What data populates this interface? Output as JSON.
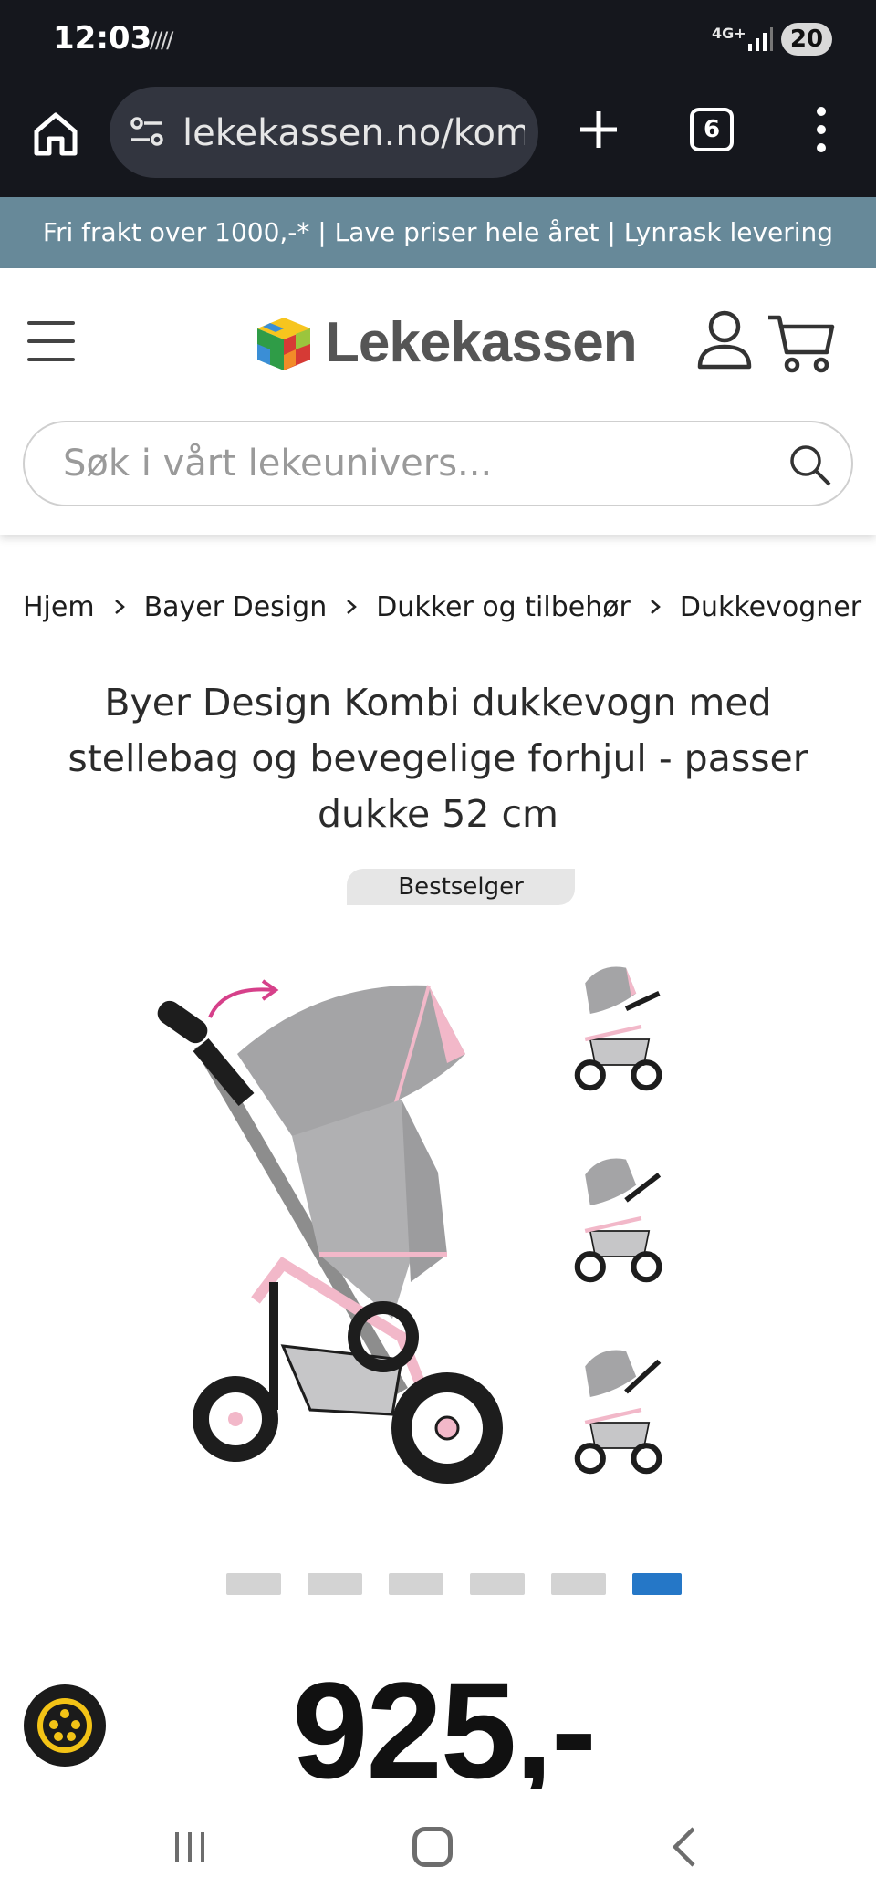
{
  "status_bar": {
    "time": "12:03",
    "extra_icon": "////",
    "network": "4G+",
    "battery": "20"
  },
  "browser": {
    "url": "lekekassen.no/kombi",
    "tab_count": "6"
  },
  "promo_banner": "Fri frakt over 1000,-* | Lave priser hele året | Lynrask levering",
  "header": {
    "logo_text": "Lekekassen",
    "search_placeholder": "Søk i vårt lekeunivers..."
  },
  "breadcrumb": [
    "Hjem",
    "Bayer Design",
    "Dukker og tilbehør",
    "Dukkevogner"
  ],
  "product": {
    "title": "Byer Design Kombi dukkevogn med stellebag og bevegelige forhjul - passer dukke 52 cm",
    "badge": "Bestselger",
    "price": "925,-",
    "gallery_count": 6,
    "gallery_active_index": 5
  },
  "colors": {
    "promo_bg": "#678999",
    "active_dot": "#2577c7",
    "pram_pink": "#f2b8c9",
    "pram_grey": "#a4a4a6"
  },
  "icons": [
    "home-icon",
    "tune-icon",
    "plus-icon",
    "tabs-icon",
    "more-vertical-icon",
    "hamburger-icon",
    "account-icon",
    "cart-icon",
    "search-icon",
    "chevron-right-icon",
    "accessibility-icon",
    "nav-recent-icon",
    "nav-home-icon",
    "nav-back-icon"
  ]
}
